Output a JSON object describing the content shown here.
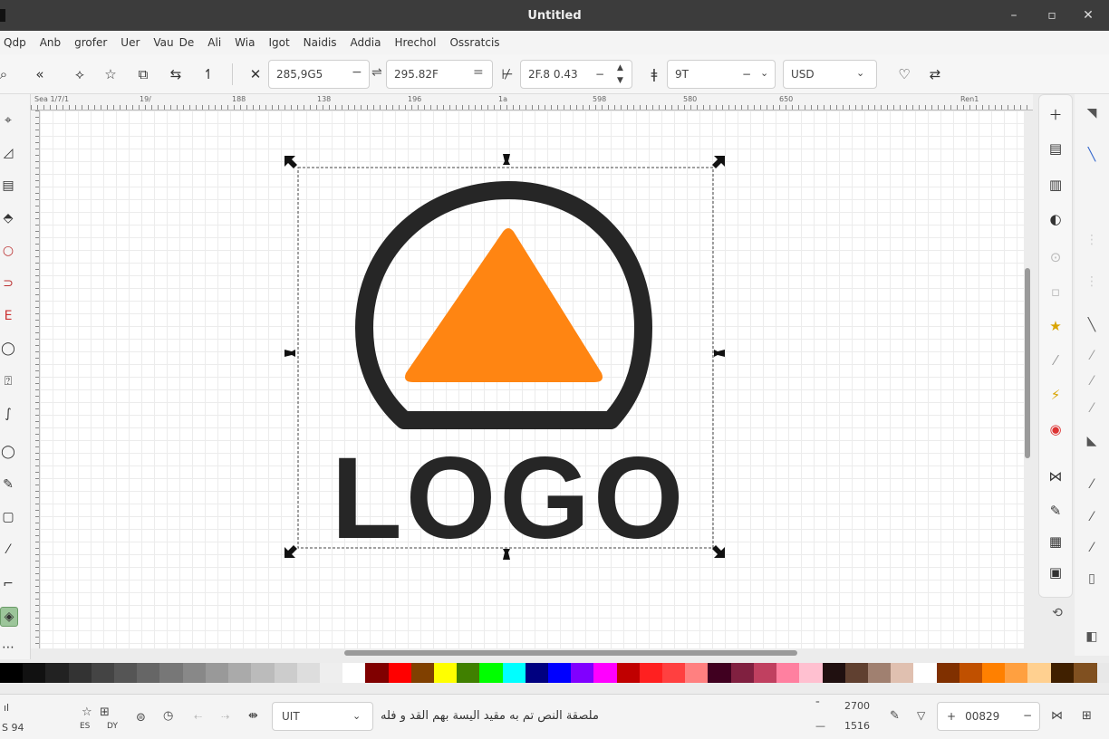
{
  "window": {
    "title": "Untitled"
  },
  "menu": [
    "Qdp",
    "Anb",
    "grofer",
    "Uer",
    "Vau",
    "De",
    "Ali",
    "Wia",
    "Igot",
    "Naidis",
    "Addia",
    "Hrechol",
    "Ossratcis"
  ],
  "toolbar": {
    "x_value": "285,9G5",
    "y_value": "295.82F",
    "w_value": "2F.8 0.43",
    "h_value": "9T",
    "unit": "USD"
  },
  "ruler": {
    "labels": [
      "Sea 1/7/1",
      "19/",
      "188",
      "138",
      "196",
      "1a",
      "598",
      "580",
      "650",
      "Ren1"
    ]
  },
  "logo": {
    "wordmark": "LOGO",
    "ring_color": "#262626",
    "triangle_color": "#ff8512",
    "text_color": "#262626"
  },
  "palette_colors": [
    "#000000",
    "#111111",
    "#222222",
    "#333333",
    "#444444",
    "#555555",
    "#666666",
    "#777777",
    "#888888",
    "#999999",
    "#aaaaaa",
    "#bbbbbb",
    "#cccccc",
    "#dddddd",
    "#eeeeee",
    "#ffffff",
    "#800000",
    "#ff0000",
    "#804000",
    "#ffff00",
    "#408000",
    "#00ff00",
    "#00ffff",
    "#000080",
    "#0000ff",
    "#8000ff",
    "#ff00ff",
    "#c00000",
    "#ff2020",
    "#ff4040",
    "#ff8080",
    "#400020",
    "#802040",
    "#c04060",
    "#ff80a0",
    "#ffc0d0",
    "#201010",
    "#604030",
    "#a08070",
    "#e0c0b0",
    "#ffffff",
    "#803000",
    "#c05000",
    "#ff8000",
    "#ffa040",
    "#ffd090",
    "#402000",
    "#805020"
  ],
  "status": {
    "layer_left": "S 94",
    "fill_label": "ES",
    "stroke_label": "DY",
    "layer_select": "UIT",
    "message": "ملصقة النص تم به مقيد اليسة بهم القد و فله",
    "coord_x": "2700",
    "coord_y": "1516",
    "zoom": "00829"
  }
}
